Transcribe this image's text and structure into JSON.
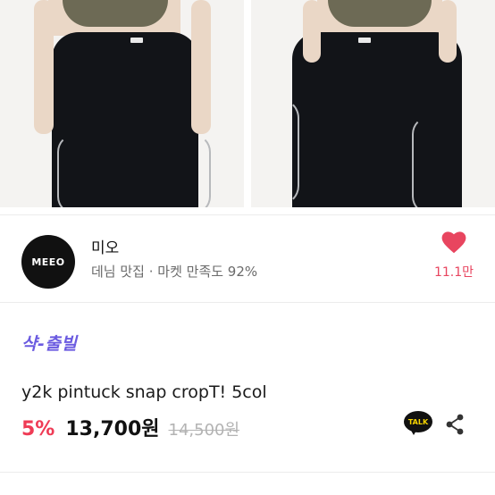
{
  "product_image": {
    "icon": "product-photo",
    "colors": {
      "pants": "#121418",
      "top": "#6d6a55",
      "background": "#f4f3f1"
    }
  },
  "seller": {
    "avatar_text": "MEEO",
    "name": "미오",
    "meta": "데님 맛집 · 마켓 만족도 92%",
    "like_count": "11.1만"
  },
  "product": {
    "brand_tag": "샥-출빌",
    "title": "y2k pintuck snap cropT! 5col",
    "discount": "5%",
    "price": "13,700원",
    "original_price": "14,500원"
  },
  "actions": {
    "talk_label": "TALK",
    "share_icon": "share-icon",
    "like_icon": "heart-icon"
  },
  "colors": {
    "accent": "#ef3b55",
    "like": "#e8455f",
    "brand": "#6a5ae0",
    "talk_bg": "#111111",
    "talk_text": "#f6d400"
  }
}
